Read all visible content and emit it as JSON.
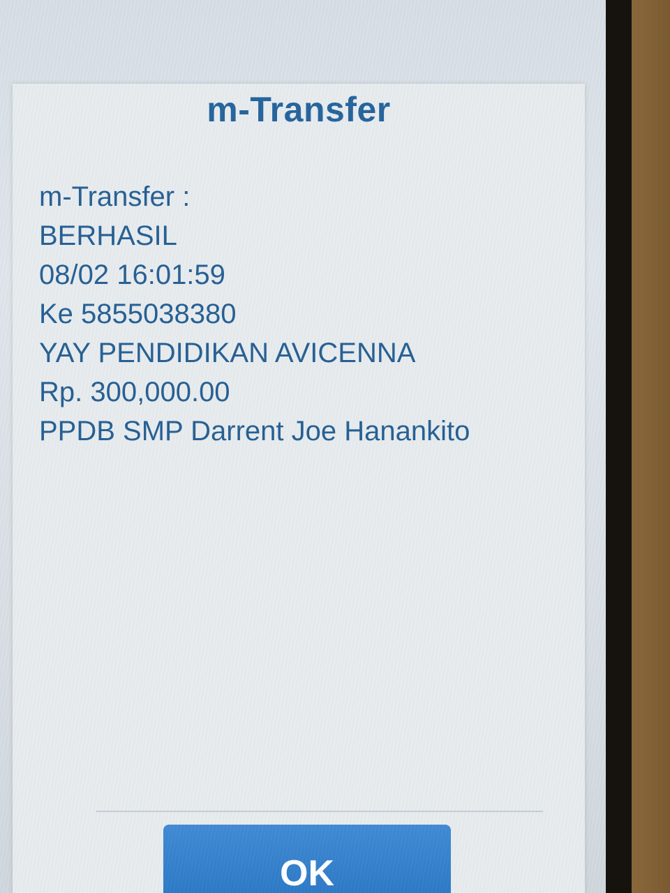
{
  "dialog": {
    "title": "m-Transfer",
    "lines": [
      "m-Transfer :",
      "BERHASIL",
      "08/02 16:01:59",
      "Ke 5855038380",
      "YAY PENDIDIKAN AVICENNA",
      "Rp. 300,000.00",
      "PPDB SMP Darrent Joe Hanankito"
    ],
    "ok_label": "OK"
  },
  "colors": {
    "title": "#1f5f99",
    "text": "#1f5a8f",
    "button": "#2a7bcb"
  }
}
